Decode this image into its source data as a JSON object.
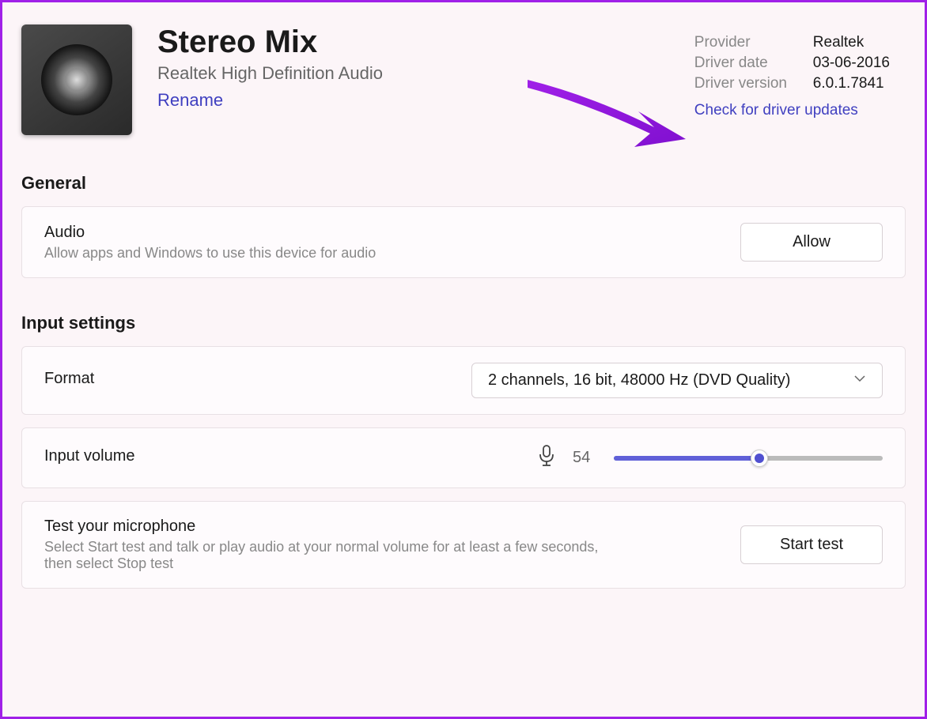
{
  "header": {
    "title": "Stereo Mix",
    "subtitle": "Realtek High Definition Audio",
    "rename_label": "Rename"
  },
  "driver": {
    "provider_label": "Provider",
    "provider_value": "Realtek",
    "date_label": "Driver date",
    "date_value": "03-06-2016",
    "version_label": "Driver version",
    "version_value": "6.0.1.7841",
    "check_updates_label": "Check for driver updates"
  },
  "sections": {
    "general_title": "General",
    "input_settings_title": "Input settings"
  },
  "audio_card": {
    "title": "Audio",
    "desc": "Allow apps and Windows to use this device for audio",
    "button": "Allow"
  },
  "format_card": {
    "label": "Format",
    "value": "2 channels, 16 bit, 48000 Hz (DVD Quality)"
  },
  "volume_card": {
    "label": "Input volume",
    "value": "54"
  },
  "test_card": {
    "title": "Test your microphone",
    "desc": "Select Start test and talk or play audio at your normal volume for at least a few seconds, then select Stop test",
    "button": "Start test"
  }
}
